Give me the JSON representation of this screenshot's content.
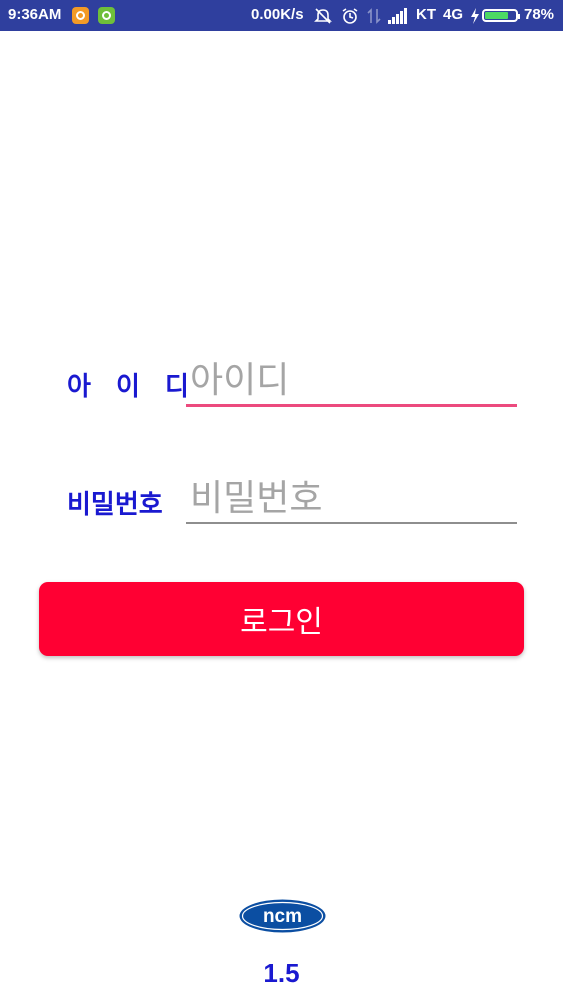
{
  "status_bar": {
    "time": "9:36AM",
    "speed": "0.00K/s",
    "carrier": "KT",
    "network": "4G",
    "battery_pct": "78%",
    "battery_level": 0.78,
    "battery_color": "#4cd964",
    "icons": [
      "app-notification-icon",
      "android-icon",
      "mute-icon",
      "alarm-icon",
      "data-arrows-icon",
      "signal-icon",
      "charging-icon",
      "battery-icon"
    ]
  },
  "form": {
    "id_label": "아 이 디",
    "id_placeholder": "아이디",
    "id_value": "",
    "pw_label": "비밀번호",
    "pw_placeholder": "비밀번호",
    "pw_value": "",
    "login_label": "로그인"
  },
  "footer": {
    "logo_text": "ncm",
    "version": "1.5"
  },
  "colors": {
    "status_bar": "#2f3f9e",
    "label_blue": "#1a19d0",
    "focus_underline": "#ec4a7e",
    "login_button": "#ff0033"
  }
}
